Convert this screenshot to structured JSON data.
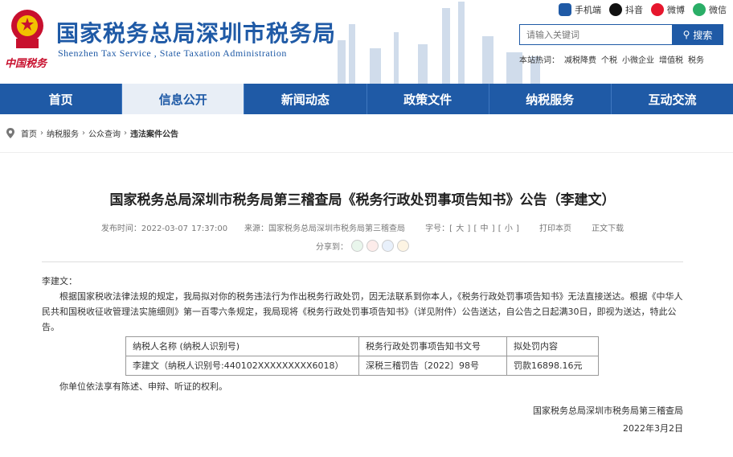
{
  "header": {
    "site_title": "国家税务总局深圳市税务局",
    "site_subtitle": "Shenzhen Tax Service , State Taxation Administration",
    "logo_text": "中国税务",
    "social": [
      "手机端",
      "抖音",
      "微博",
      "微信"
    ],
    "search_placeholder": "请输入关键词",
    "search_button": "搜索",
    "hot_label": "本站热词：",
    "hot_words": [
      "减税降费",
      "个税",
      "小微企业",
      "增值税",
      "税务"
    ]
  },
  "nav": {
    "items": [
      "首页",
      "信息公开",
      "新闻动态",
      "政策文件",
      "纳税服务",
      "互动交流"
    ],
    "active_index": 1
  },
  "breadcrumb": [
    "首页",
    "纳税服务",
    "公众查询",
    "违法案件公告"
  ],
  "article": {
    "title": "国家税务总局深圳市税务局第三稽查局《税务行政处罚事项告知书》公告（李建文）",
    "publish_time": "发布时间：2022-03-07 17:37:00",
    "source": "来源：国家税务总局深圳市税务局第三稽查局",
    "font_label": "字号：",
    "font_big": "大",
    "font_mid": "中",
    "font_small": "小",
    "print": "打印本页",
    "download": "正文下载",
    "share_label": "分享到：",
    "salutation": "李建文：",
    "para1": "根据国家税收法律法规的规定，我局拟对你的税务违法行为作出税务行政处罚，因无法联系到你本人，《税务行政处罚事项告知书》无法直接送达。根据《中华人民共和国税收征收管理法实施细则》第一百零六条规定，我局现将《税务行政处罚事项告知书》（详见附件）公告送达，自公告之日起满30日，即视为送达，特此公告。",
    "table_headers": [
      "纳税人名称 (纳税人识别号)",
      "税务行政处罚事项告知书文号",
      "拟处罚内容"
    ],
    "table_row": [
      "李建文（纳税人识别号:440102XXXXXXXXX6018）",
      "深税三稽罚告〔2022〕98号",
      "罚款16898.16元"
    ],
    "para2": "你单位依法享有陈述、申辩、听证的权利。",
    "sign_org": "国家税务总局深圳市税务局第三稽查局",
    "sign_date": "2022年3月2日"
  }
}
